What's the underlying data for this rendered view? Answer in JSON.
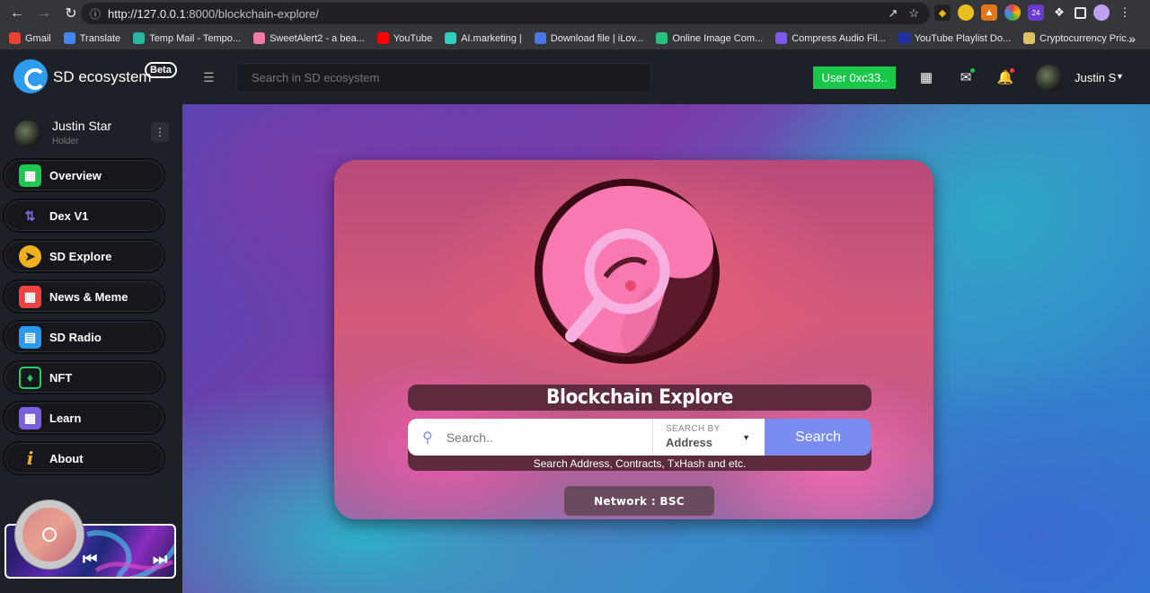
{
  "browser": {
    "url_host": "http://127.0.0.1",
    "url_rest": ":8000/blockchain-explore/",
    "ext_badge_1": "24",
    "bookmarks": [
      {
        "label": "Gmail",
        "color": "#ea4335"
      },
      {
        "label": "Translate",
        "color": "#4285f4"
      },
      {
        "label": "Temp Mail - Tempo...",
        "color": "#2bb6a0"
      },
      {
        "label": "SweetAlert2 - a bea...",
        "color": "#f07aa0"
      },
      {
        "label": "YouTube",
        "color": "#ff0000"
      },
      {
        "label": "AI.marketing |",
        "color": "#2fd0c0"
      },
      {
        "label": "Download file | iLov...",
        "color": "#4a78e8"
      },
      {
        "label": "Online Image Com...",
        "color": "#2ac080"
      },
      {
        "label": "Compress Audio Fil...",
        "color": "#7a5af0"
      },
      {
        "label": "YouTube Playlist Do...",
        "color": "#2030a0"
      },
      {
        "label": "Cryptocurrency Pric...",
        "color": "#e0c060"
      }
    ]
  },
  "header": {
    "brand": "SD ecosystem",
    "beta": "Beta",
    "search_placeholder": "Search in SD ecosystem",
    "user_button": "User 0xc33..",
    "username": "Justin S"
  },
  "sidebar": {
    "name": "Justin Star",
    "role": "Holder",
    "items": [
      {
        "label": "Overview",
        "icon": "grid-icon",
        "color": "#1ec850"
      },
      {
        "label": "Dex V1",
        "icon": "swap-icon",
        "color": "#6a5ad8"
      },
      {
        "label": "SD Explore",
        "icon": "compass-icon",
        "color": "#f0b020"
      },
      {
        "label": "News & Meme",
        "icon": "news-icon",
        "color": "#f04040"
      },
      {
        "label": "SD Radio",
        "icon": "radio-icon",
        "color": "#2a9af0"
      },
      {
        "label": "NFT",
        "icon": "card-icon",
        "color": "#20d060"
      },
      {
        "label": "Learn",
        "icon": "presentation-icon",
        "color": "#7a60e0"
      },
      {
        "label": "About",
        "icon": "info-icon",
        "color": "#f0b020"
      }
    ]
  },
  "main": {
    "title": "Blockchain Explore",
    "search_placeholder": "Search..",
    "search_by_caption": "SEARCH BY",
    "search_by_value": "Address",
    "search_button": "Search",
    "hint": "Search Address, Contracts, TxHash and etc.",
    "network": "Network : BSC"
  }
}
